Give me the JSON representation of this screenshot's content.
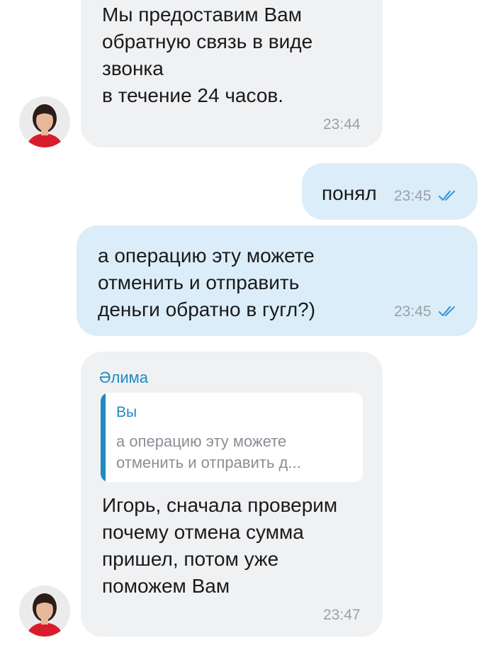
{
  "messages": [
    {
      "direction": "incoming",
      "text": "Мы предоставим Вам\nобратную связь в виде\nзвонка\nв течение 24 часов.",
      "time": "23:44"
    },
    {
      "direction": "outgoing",
      "text": "понял",
      "time": "23:45",
      "status_icon": "double-check-icon"
    },
    {
      "direction": "outgoing",
      "text": "а операцию эту можете\nотменить и отправить\nденьги обратно в гугл?)",
      "time": "23:45",
      "status_icon": "double-check-icon"
    },
    {
      "direction": "incoming",
      "sender": "Әлима",
      "reply": {
        "author": "Вы",
        "text": "а операцию эту можете\nотменить и отправить д..."
      },
      "text": " Игорь, сначала проверим\nпочему отмена сумма\nпришел, потом уже\nпоможем Вам",
      "time": "23:47"
    }
  ],
  "colors": {
    "incoming_bubble": "#f0f1f3",
    "outgoing_bubble": "#dbedf8",
    "accent": "#1f8ac4",
    "timestamp": "#9aa0a6",
    "check": "#3d9bd6"
  }
}
